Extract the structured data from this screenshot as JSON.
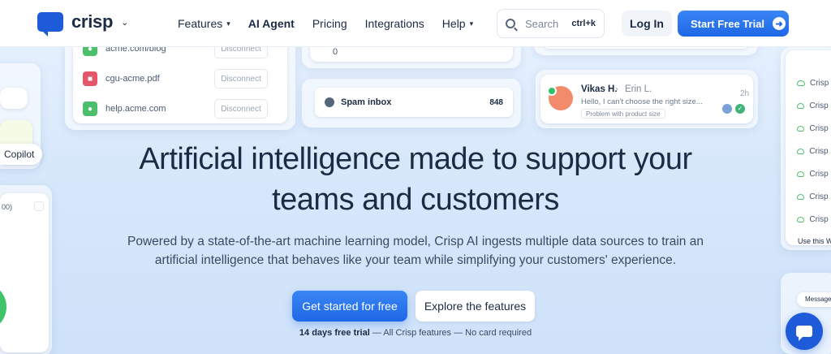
{
  "nav": {
    "logo_text": "crisp",
    "menu": [
      {
        "label": "Features",
        "has_chevron": true
      },
      {
        "label": "AI Agent",
        "has_chevron": false
      },
      {
        "label": "Pricing",
        "has_chevron": false
      },
      {
        "label": "Integrations",
        "has_chevron": false
      },
      {
        "label": "Help",
        "has_chevron": true
      }
    ],
    "search_placeholder": "Search",
    "search_shortcut": "ctrl+k",
    "login_label": "Log In",
    "trial_label": "Start Free Trial"
  },
  "sources": [
    {
      "name": "acme.com/blog",
      "icon_color": "#4cbf6a",
      "action": "Disconnect"
    },
    {
      "name": "cgu-acme.pdf",
      "icon_color": "#e2576a",
      "action": "Disconnect"
    },
    {
      "name": "help.acme.com",
      "icon_color": "#4cbf6a",
      "action": "Disconnect"
    }
  ],
  "counter_value": "0",
  "spam": {
    "label": "Spam inbox",
    "count": "848"
  },
  "conversation": {
    "from": "Vikas H.",
    "to": "Erin L.",
    "preview": "Hello, I can't choose the right size...",
    "tag": "Problem with product size",
    "time": "2h"
  },
  "copilot_label": "Copilot",
  "left_panel_text": "00)",
  "right_panel": {
    "items": [
      "Crisp",
      "Crisp I",
      "Crisp I",
      "Crisp (",
      "Crisp I",
      "Crisp (",
      "Crisp I"
    ],
    "footer": "Use this We",
    "message_label": "Message"
  },
  "hero": {
    "title_line1": "Artificial intelligence made to support your",
    "title_line2": "teams and customers",
    "subtitle": "Powered by a state-of-the-art machine learning model, Crisp AI ingests multiple data sources to train an artificial intelligence that behaves like your team while simplifying your customers' experience.",
    "cta_primary": "Get started for free",
    "cta_secondary": "Explore the features",
    "fine_bold": "14 days free trial",
    "fine_rest": " — All Crisp features — No card required"
  },
  "colors": {
    "brand": "#1e5bd8",
    "accent": "#3a86f5",
    "text": "#1b2b43"
  }
}
